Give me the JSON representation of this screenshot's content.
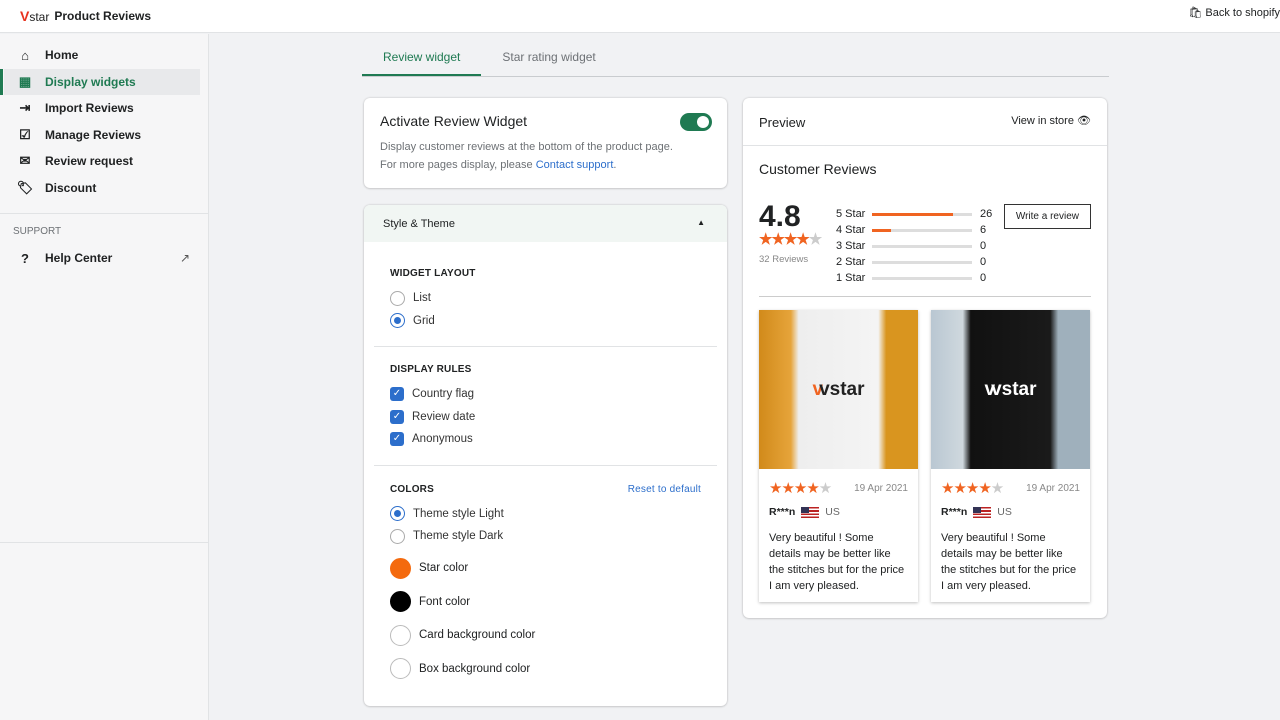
{
  "app": {
    "logo": "V",
    "logo_text": "star",
    "title": "Product Reviews",
    "back": "Back to shopify"
  },
  "sidebar": {
    "items": [
      {
        "label": "Home",
        "icon": "home-icon"
      },
      {
        "label": "Display widgets",
        "icon": "widgets-icon",
        "active": true
      },
      {
        "label": "Import Reviews",
        "icon": "import-icon"
      },
      {
        "label": "Manage Reviews",
        "icon": "manage-icon"
      },
      {
        "label": "Review request",
        "icon": "mail-icon"
      },
      {
        "label": "Discount",
        "icon": "discount-icon"
      }
    ],
    "support_label": "SUPPORT",
    "help": "Help Center"
  },
  "tabs": [
    {
      "label": "Review widget",
      "active": true
    },
    {
      "label": "Star rating widget"
    }
  ],
  "activate": {
    "title": "Activate Review Widget",
    "desc": "Display customer reviews at the bottom of the product page.",
    "desc2": "For more pages display, please ",
    "link": "Contact support",
    "enabled": true
  },
  "style": {
    "title": "Style & Theme",
    "layout_label": "WIDGET LAYOUT",
    "layout_options": [
      "List",
      "Grid"
    ],
    "layout_selected": "Grid",
    "rules_label": "DISPLAY RULES",
    "rules": [
      "Country flag",
      "Review date",
      "Anonymous"
    ],
    "colors_label": "COLORS",
    "reset": "Reset to default",
    "themes": [
      "Theme style Light",
      "Theme style Dark"
    ],
    "theme_selected": "Theme style Light",
    "colors": [
      {
        "label": "Star color",
        "value": "#f46a0e"
      },
      {
        "label": "Font color",
        "value": "#000000"
      },
      {
        "label": "Card background color",
        "value": "#ffffff"
      },
      {
        "label": "Box background color",
        "value": "#ffffff"
      }
    ]
  },
  "preview": {
    "title": "Preview",
    "view": "View in store",
    "heading": "Customer Reviews",
    "rating": "4.8",
    "reviews": "32 Reviews",
    "write": "Write a review",
    "bars": [
      {
        "label": "5 Star",
        "count": "26",
        "fraction": 0.81
      },
      {
        "label": "4 Star",
        "count": "6",
        "fraction": 0.19
      },
      {
        "label": "3 Star",
        "count": "0",
        "fraction": 0
      },
      {
        "label": "2 Star",
        "count": "0",
        "fraction": 0
      },
      {
        "label": "1 Star",
        "count": "0",
        "fraction": 0
      }
    ],
    "cards": [
      {
        "date": "19 Apr 2021",
        "name": "R***n",
        "country": "US",
        "text": "Very beautiful ! Some details may be better like the stitches but for the price I am very pleased.",
        "brand": "vstar"
      },
      {
        "date": "19 Apr 2021",
        "name": "R***n",
        "country": "US",
        "text": "Very beautiful ! Some details may be better like the stitches but for the price I am very pleased.",
        "brand": "vstar"
      }
    ]
  },
  "accent": "#1f7a52",
  "star_color": "#f06421"
}
